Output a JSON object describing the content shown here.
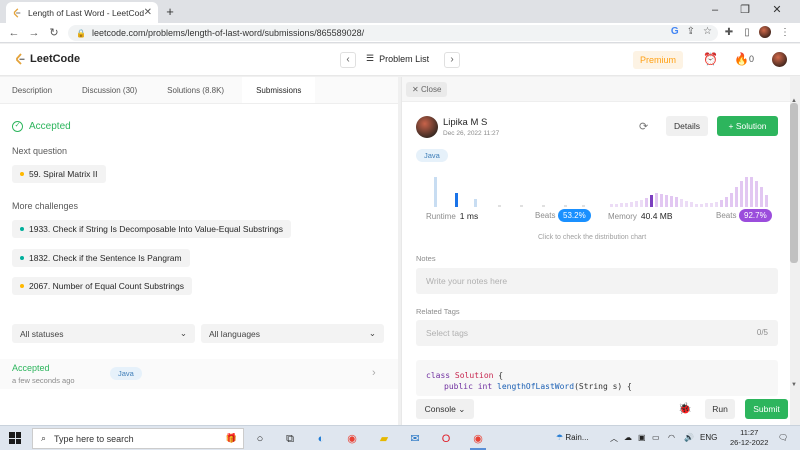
{
  "browser": {
    "tab_title": "Length of Last Word - LeetCode",
    "url": "leetcode.com/problems/length-of-last-word/submissions/865589028/"
  },
  "header": {
    "logo_text": "LeetCode",
    "problem_list_label": "Problem List",
    "premium_label": "Premium",
    "streak_count": "0"
  },
  "left": {
    "tabs": [
      {
        "label": "Description"
      },
      {
        "label": "Discussion (30)"
      },
      {
        "label": "Solutions (8.8K)"
      },
      {
        "label": "Submissions"
      }
    ],
    "status_title": "Accepted",
    "next_question_label": "Next question",
    "next_question": {
      "label": "59. Spiral Matrix II",
      "color": "#ffb800"
    },
    "more_challenges_label": "More challenges",
    "challenges": [
      {
        "label": "1933. Check if String Is Decomposable Into Value-Equal Substrings",
        "color": "#00af9b"
      },
      {
        "label": "1832. Check if the Sentence Is Pangram",
        "color": "#00af9b"
      },
      {
        "label": "2067. Number of Equal Count Substrings",
        "color": "#ffb800"
      }
    ],
    "filters": {
      "status": "All statuses",
      "language": "All languages"
    },
    "submission": {
      "status": "Accepted",
      "time": "a few seconds ago",
      "language": "Java"
    }
  },
  "right": {
    "close_label": "Close",
    "user_name": "Lipika M S",
    "date": "Dec 26, 2022 11:27",
    "details_label": "Details",
    "solution_label": "Solution",
    "language": "Java",
    "runtime_label": "Runtime",
    "runtime_value": "1 ms",
    "runtime_beats_label": "Beats",
    "runtime_beats": "53.2%",
    "memory_label": "Memory",
    "memory_value": "40.4 MB",
    "memory_beats_label": "Beats",
    "memory_beats": "92.7%",
    "distribution_note": "Click to check the distribution chart",
    "notes_label": "Notes",
    "notes_placeholder": "Write your notes here",
    "tags_label": "Related Tags",
    "tags_placeholder": "Select tags",
    "tags_count": "0/5",
    "code_line1_kw": "class",
    "code_line1_cls": "Solution",
    "code_line1_rest": " {",
    "code_line2_kw": "public int",
    "code_line2_fn": "lengthOfLastWord",
    "code_line2_rest": "(String s) {",
    "console_label": "Console",
    "run_label": "Run",
    "submit_label": "Submit",
    "colors": {
      "green": "#2db55d",
      "blue_badge": "#1a90ff",
      "purple_badge": "#9b4ddc"
    }
  },
  "taskbar": {
    "search_placeholder": "Type here to search",
    "weather": "Rain...",
    "language": "ENG",
    "time": "11:27",
    "date": "26-12-2022"
  }
}
